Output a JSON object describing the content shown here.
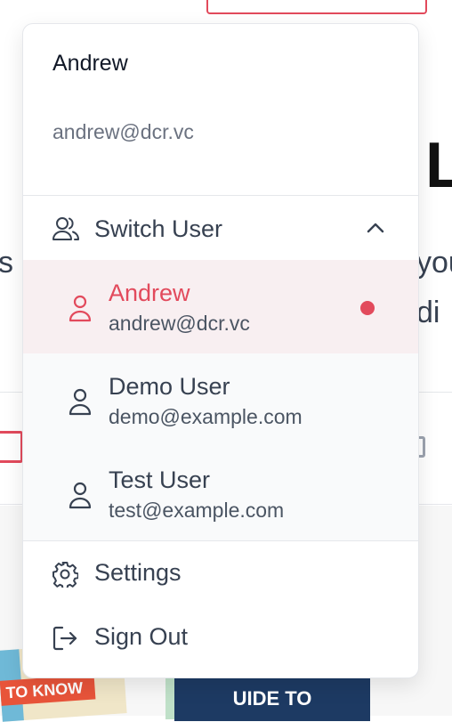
{
  "background": {
    "big_letter": "L",
    "frag_left": "s",
    "frag_right_1": "you",
    "frag_right_2": "di",
    "book1_text": "TO KNOW",
    "book2_text": "UIDE TO"
  },
  "dropdown": {
    "user_name": "Andrew",
    "user_email": "andrew@dcr.vc",
    "switch_user_label": "Switch User",
    "users": [
      {
        "name": "Andrew",
        "email": "andrew@dcr.vc",
        "active": true
      },
      {
        "name": "Demo User",
        "email": "demo@example.com",
        "active": false
      },
      {
        "name": "Test User",
        "email": "test@example.com",
        "active": false
      }
    ],
    "settings_label": "Settings",
    "sign_out_label": "Sign Out"
  },
  "colors": {
    "accent": "#e24a5c",
    "active_bg": "#f8eff1",
    "text": "#374151",
    "muted": "#6b7280"
  },
  "icons": [
    "users-icon",
    "chevron-up-icon",
    "user-icon",
    "active-dot",
    "gear-icon",
    "sign-out-icon"
  ]
}
